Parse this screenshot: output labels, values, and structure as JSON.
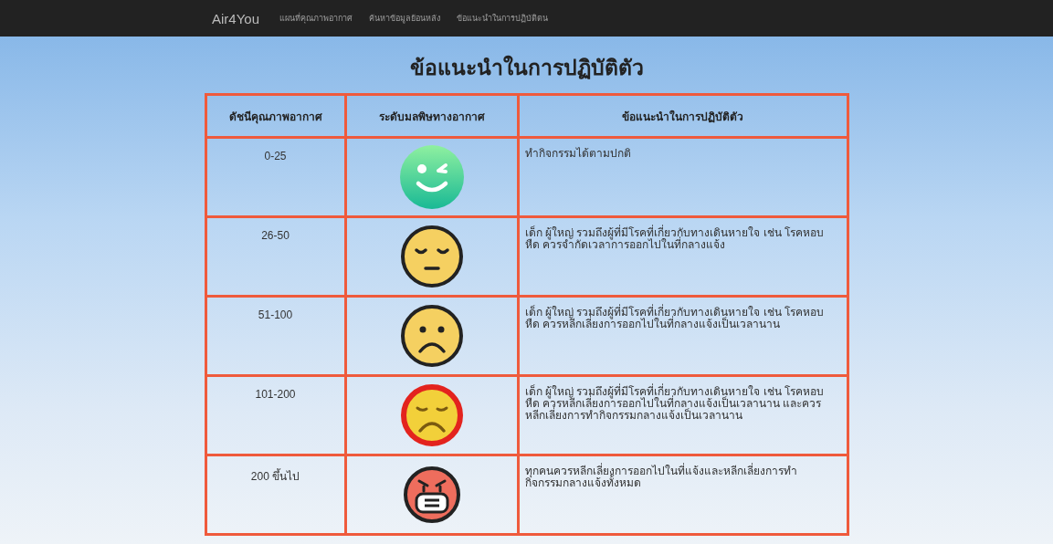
{
  "navbar": {
    "brand": "Air4You",
    "links": [
      "แผนที่คุณภาพอากาศ",
      "ค้นหาข้อมูลย้อนหลัง",
      "ข้อแนะนำในการปฏิบัติตน"
    ]
  },
  "title": "ข้อแนะนำในการปฏิบัติตัว",
  "table": {
    "columns": [
      "ดัชนีคุณภาพอากาศ",
      "ระดับมลพิษทางอากาศ",
      "ข้อแนะนำในการปฏิบัติตัว"
    ],
    "rows": [
      {
        "index": "0-25",
        "kind": "wink",
        "advice": "ทำกิจกรรมได้ตามปกติ"
      },
      {
        "index": "26-50",
        "kind": "sleepy",
        "advice": "เด็ก ผู้ใหญ่ รวมถึงผู้ที่มีโรคที่เกี่ยวกับทางเดินหายใจ เช่น โรคหอบหืด ควรจำกัดเวลาการออกไปในที่กลางแจ้ง"
      },
      {
        "index": "51-100",
        "kind": "sad",
        "advice": "เด็ก ผู้ใหญ่ รวมถึงผู้ที่มีโรคที่เกี่ยวกับทางเดินหายใจ เช่น โรคหอบหืด ควรหลีกเลี่ยงการออกไปในที่กลางแจ้งเป็นเวลานาน"
      },
      {
        "index": "101-200",
        "kind": "upset",
        "advice": "เด็ก ผู้ใหญ่ รวมถึงผู้ที่มีโรคที่เกี่ยวกับทางเดินหายใจ เช่น โรคหอบหืด ควรหลีกเลี่ยงการออกไปในที่กลางแจ้งเป็นเวลานาน และควรหลีกเลี่ยงการทำกิจกรรมกลางแจ้งเป็นเวลานาน"
      },
      {
        "index": "200 ขึ้นไป",
        "kind": "mask",
        "advice": "ทุกคนควรหลีกเลี่ยงการออกไปในที่แจ้งและหลีกเลี่ยงการทำกิจกรรมกลางแจ้งทั้งหมด"
      }
    ]
  }
}
